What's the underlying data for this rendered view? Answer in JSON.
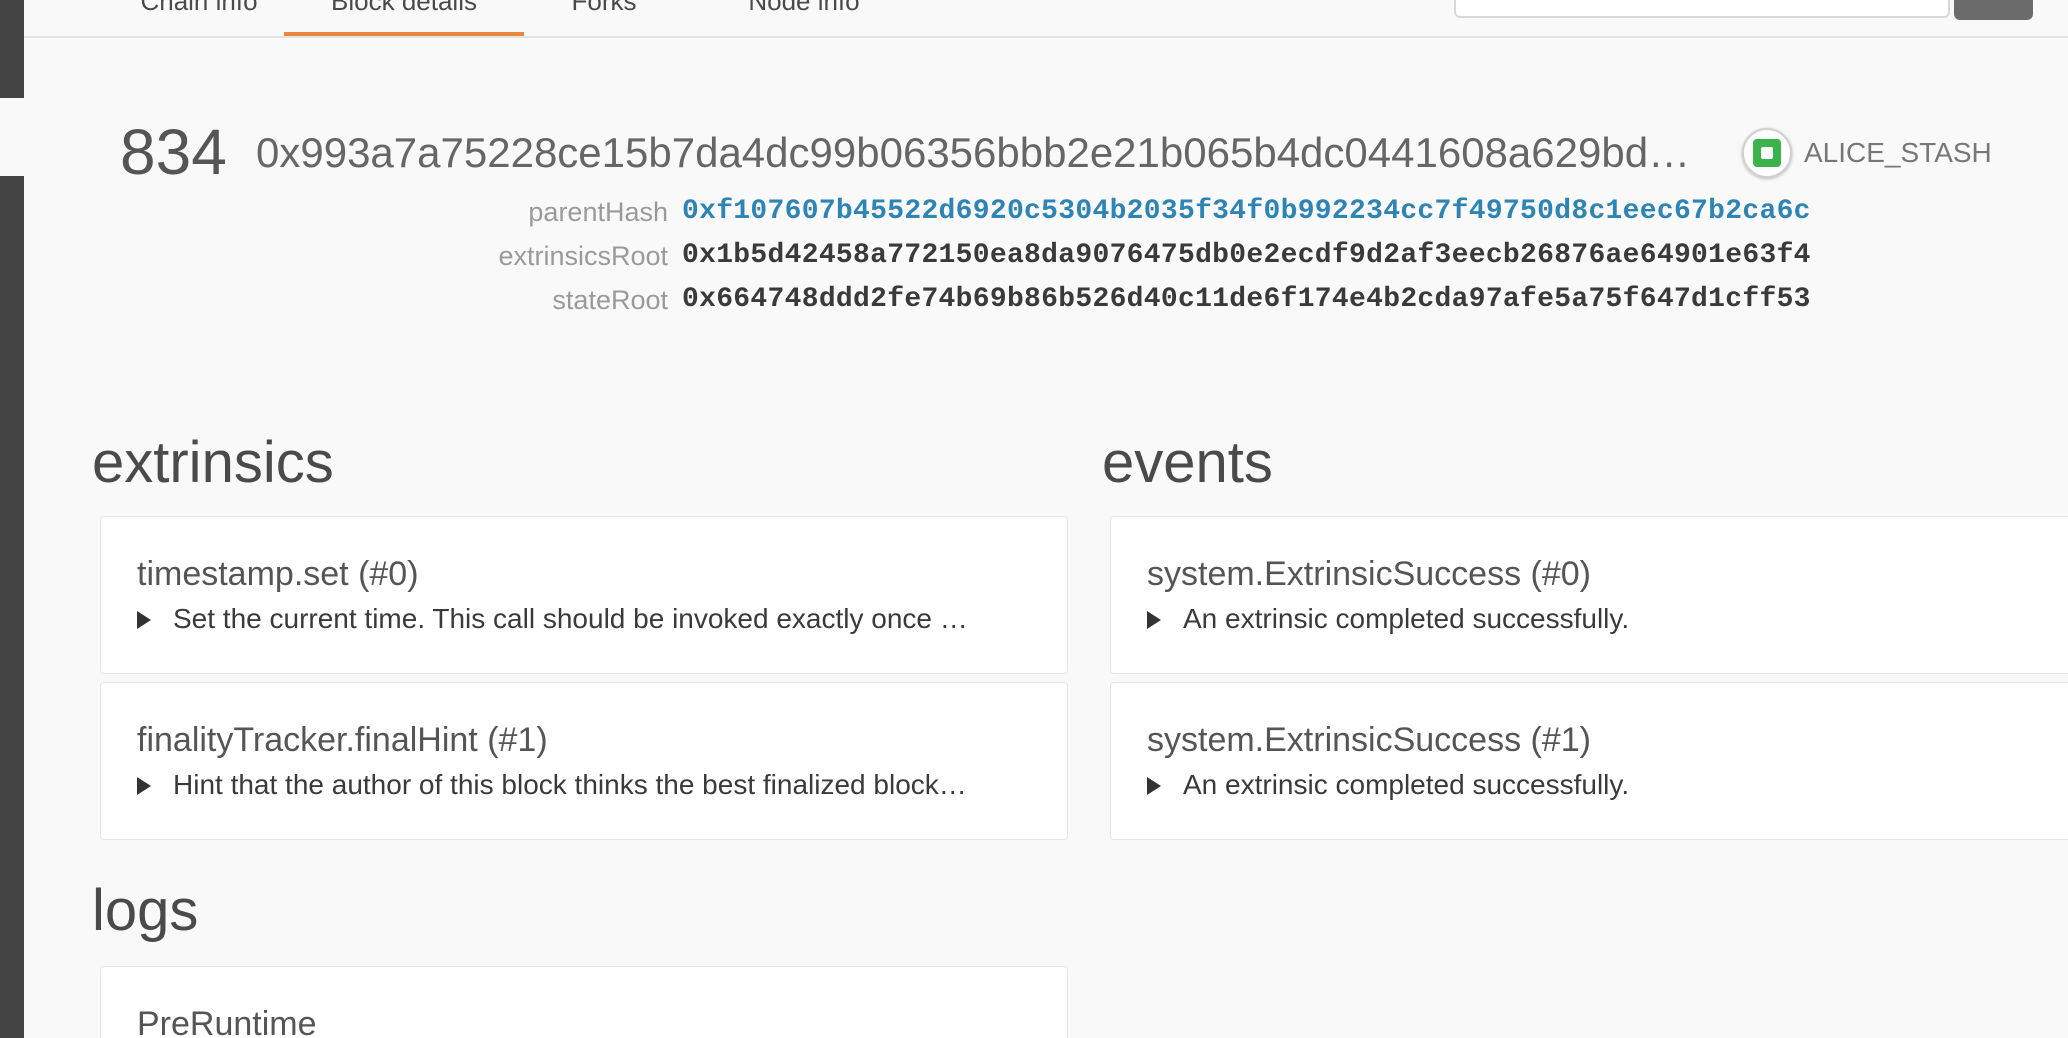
{
  "tabs": [
    {
      "label": "Chain info"
    },
    {
      "label": "Block details"
    },
    {
      "label": "Forks"
    },
    {
      "label": "Node info"
    }
  ],
  "active_tab": "Block details",
  "accent_color": "#e8883f",
  "block": {
    "number": "834",
    "hash": "0x993a7a75228ce15b7da4dc99b06356bbb2e21b065b4dc0441608a629bd…",
    "author": "ALICE_STASH",
    "parentHash_label": "parentHash",
    "parentHash": "0xf107607b45522d6920c5304b2035f34f0b992234cc7f49750d8c1eec67b2ca6c",
    "extrinsicsRoot_label": "extrinsicsRoot",
    "extrinsicsRoot": "0x1b5d42458a772150ea8da9076475db0e2ecdf9d2af3eecb26876ae64901e63f4",
    "stateRoot_label": "stateRoot",
    "stateRoot": "0x664748ddd2fe74b69b86b526d40c11de6f174e4b2cda97afe5a75f647d1cff53"
  },
  "extrinsics": {
    "title": "extrinsics",
    "items": [
      {
        "title": "timestamp.set (#0)",
        "summary": "Set the current time. This call should be invoked exactly once …"
      },
      {
        "title": "finalityTracker.finalHint (#1)",
        "summary": "Hint that the author of this block thinks the best finalized block…"
      }
    ]
  },
  "events": {
    "title": "events",
    "items": [
      {
        "title": "system.ExtrinsicSuccess (#0)",
        "summary": "An extrinsic completed successfully."
      },
      {
        "title": "system.ExtrinsicSuccess (#1)",
        "summary": "An extrinsic completed successfully."
      }
    ]
  },
  "logs": {
    "title": "logs",
    "items": [
      {
        "title": "PreRuntime"
      }
    ]
  }
}
